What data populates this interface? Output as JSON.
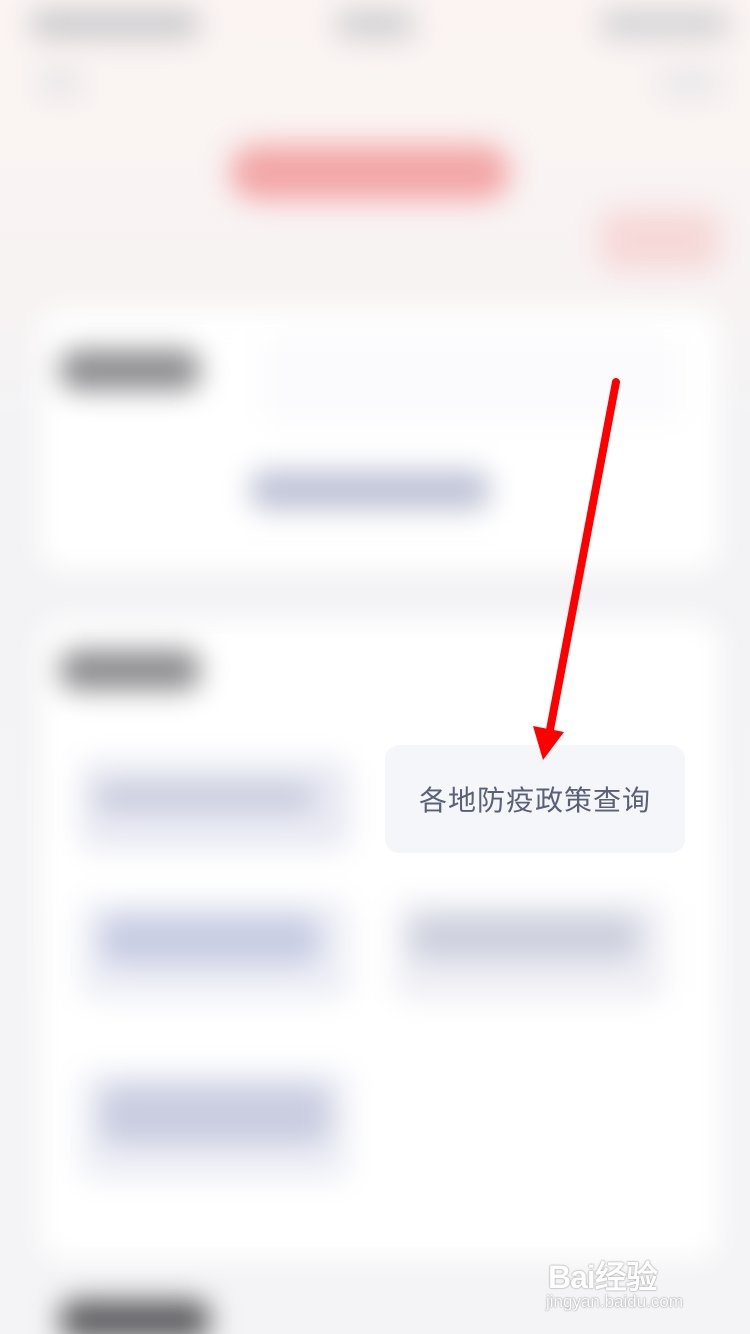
{
  "highlight": {
    "label": "各地防疫政策查询"
  },
  "annotation": {
    "arrow_color": "#ff0000"
  },
  "watermark": {
    "logo_text": "Bai经验",
    "url": "jingyan.baidu.com"
  }
}
